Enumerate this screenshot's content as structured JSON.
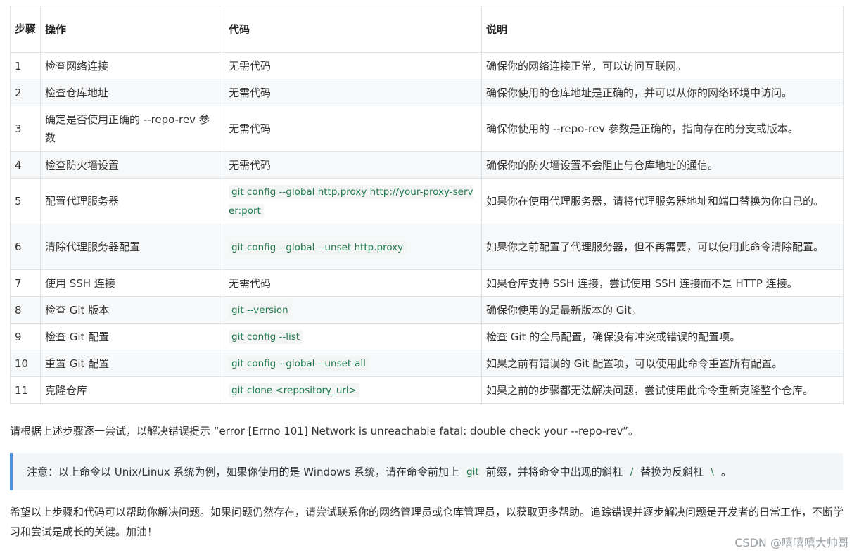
{
  "table": {
    "headers": [
      "步骤",
      "操作",
      "代码",
      "说明"
    ],
    "rows": [
      {
        "step": "1",
        "action": "检查网络连接",
        "code": "无需代码",
        "code_is_cmd": false,
        "desc": "确保你的网络连接正常，可以访问互联网。"
      },
      {
        "step": "2",
        "action": "检查仓库地址",
        "code": "无需代码",
        "code_is_cmd": false,
        "desc": "确保你使用的仓库地址是正确的，并可以从你的网络环境中访问。"
      },
      {
        "step": "3",
        "action": "确定是否使用正确的 --repo-rev 参数",
        "code": "无需代码",
        "code_is_cmd": false,
        "desc": "确保你使用的 --repo-rev 参数是正确的，指向存在的分支或版本。"
      },
      {
        "step": "4",
        "action": "检查防火墙设置",
        "code": "无需代码",
        "code_is_cmd": false,
        "desc": "确保你的防火墙设置不会阻止与仓库地址的通信。"
      },
      {
        "step": "5",
        "action": "配置代理服务器",
        "code": "git config --global http.proxy http://your-proxy-server:port",
        "code_is_cmd": true,
        "desc": "如果你在使用代理服务器，请将代理服务器地址和端口替换为你自己的。"
      },
      {
        "step": "6",
        "action": "清除代理服务器配置",
        "code": "git config --global --unset http.proxy",
        "code_is_cmd": true,
        "desc": "如果你之前配置了代理服务器，但不再需要，可以使用此命令清除配置。"
      },
      {
        "step": "7",
        "action": "使用 SSH 连接",
        "code": "无需代码",
        "code_is_cmd": false,
        "desc": "如果仓库支持 SSH 连接，尝试使用 SSH 连接而不是 HTTP 连接。"
      },
      {
        "step": "8",
        "action": "检查 Git 版本",
        "code": "git --version",
        "code_is_cmd": true,
        "desc": "确保你使用的是最新版本的 Git。"
      },
      {
        "step": "9",
        "action": "检查 Git 配置",
        "code": "git config --list",
        "code_is_cmd": true,
        "desc": "检查 Git 的全局配置，确保没有冲突或错误的配置项。"
      },
      {
        "step": "10",
        "action": "重置 Git 配置",
        "code": "git config --global --unset-all",
        "code_is_cmd": true,
        "desc": "如果之前有错误的 Git 配置项，可以使用此命令重置所有配置。"
      },
      {
        "step": "11",
        "action": "克隆仓库",
        "code": "git clone <repository_url>",
        "code_is_cmd": true,
        "desc": "如果之前的步骤都无法解决问题，尝试使用此命令重新克隆整个仓库。"
      }
    ]
  },
  "paragraph1": "请根据上述步骤逐一尝试，以解决错误提示 “error [Errno 101] Network is unreachable fatal: double check your --repo-rev”。",
  "note": {
    "part1": "注意：以上命令以 Unix/Linux 系统为例，如果你使用的是 Windows 系统，请在命令前加上",
    "code1": "git",
    "part2": "前缀，并将命令中出现的斜杠",
    "code2": "/",
    "part3": "替换为反斜杠",
    "code3": "\\",
    "part4": "。"
  },
  "paragraph2": "希望以上步骤和代码可以帮助你解决问题。如果问题仍然存在，请尝试联系你的网络管理员或仓库管理员，以获取更多帮助。追踪错误并逐步解决问题是开发者的日常工作，不断学习和尝试是成长的关键。加油！",
  "watermark": "CSDN @嘻嘻嘻大帅哥"
}
